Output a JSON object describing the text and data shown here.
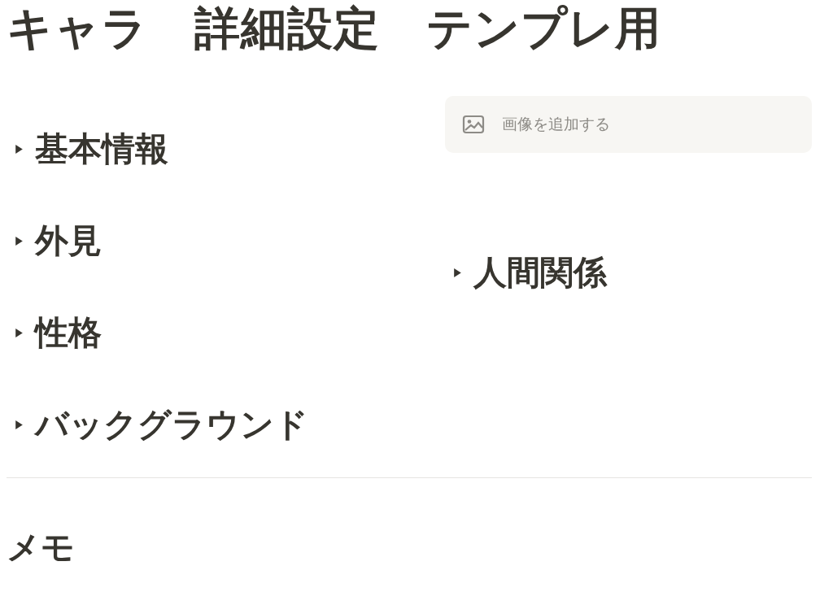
{
  "title": "キャラ　詳細設定　テンプレ用",
  "left_column": {
    "toggles": [
      {
        "label": "基本情報",
        "expanded": false
      },
      {
        "label": "外見",
        "expanded": false
      },
      {
        "label": "性格",
        "expanded": false
      },
      {
        "label": "バックグラウンド",
        "expanded": false
      }
    ]
  },
  "right_column": {
    "image_placeholder": {
      "label": "画像を追加する"
    },
    "toggles": [
      {
        "label": "人間関係",
        "expanded": false
      }
    ]
  },
  "memo_heading": "メモ"
}
